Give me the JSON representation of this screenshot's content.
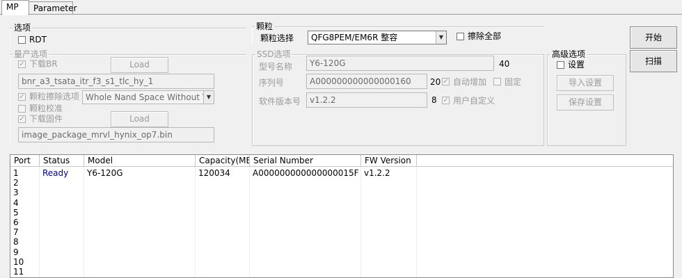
{
  "tabs": [
    {
      "label": "MP"
    },
    {
      "label": "Parameter"
    }
  ],
  "options": {
    "legend": "选项",
    "rdt_label": "RDT"
  },
  "mp_options": {
    "legend": "量产选项",
    "download_br_label": "下载BR",
    "download_br_checked": true,
    "load_button": "Load",
    "br_file": "bnr_a3_tsata_itr_f3_s1_tlc_hy_1",
    "erase_label": "颗粒擦除选项",
    "erase_checked": true,
    "erase_value": "Whole Nand Space Without WPE",
    "verify_label": "颗粒校准",
    "download_fw_label": "下载固件",
    "download_fw_checked": true,
    "load_button2": "Load",
    "fw_file": "image_package_mrvl_hynix_op7.bin"
  },
  "flash": {
    "legend": "颗粒",
    "select_label": "颗粒选择",
    "select_value": "QFG8PEM/EM6R 整容",
    "erase_all_label": "擦除全部"
  },
  "ssd": {
    "legend": "SSD选项",
    "model_label": "型号名称",
    "model_value": "Y6-120G",
    "model_len": "40",
    "serial_label": "序列号",
    "serial_value": "A000000000000000160",
    "serial_len": "20",
    "auto_inc_label": "自动增加",
    "auto_inc_checked": true,
    "fixed_label": "固定",
    "fw_label": "软件版本号",
    "fw_value": "v1.2.2",
    "fw_len": "8",
    "custom_label": "用户自定义",
    "custom_checked": true
  },
  "advanced": {
    "legend": "高级选项",
    "settings_label": "设置",
    "import_button": "导入设置",
    "save_button": "保存设置"
  },
  "actions": {
    "start_button": "开始",
    "scan_button": "扫描"
  },
  "table": {
    "columns": [
      "Port",
      "Status",
      "Model",
      "Capacity(MB)",
      "Serial Number",
      "FW Version"
    ],
    "rows": [
      {
        "port": "1",
        "status": "Ready",
        "model": "Y6-120G",
        "capacity": "120034",
        "serial": "A000000000000000015F",
        "fw": "v1.2.2"
      },
      {
        "port": "2",
        "status": "",
        "model": "",
        "capacity": "",
        "serial": "",
        "fw": ""
      },
      {
        "port": "3",
        "status": "",
        "model": "",
        "capacity": "",
        "serial": "",
        "fw": ""
      },
      {
        "port": "4",
        "status": "",
        "model": "",
        "capacity": "",
        "serial": "",
        "fw": ""
      },
      {
        "port": "5",
        "status": "",
        "model": "",
        "capacity": "",
        "serial": "",
        "fw": ""
      },
      {
        "port": "6",
        "status": "",
        "model": "",
        "capacity": "",
        "serial": "",
        "fw": ""
      },
      {
        "port": "7",
        "status": "",
        "model": "",
        "capacity": "",
        "serial": "",
        "fw": ""
      },
      {
        "port": "8",
        "status": "",
        "model": "",
        "capacity": "",
        "serial": "",
        "fw": ""
      },
      {
        "port": "9",
        "status": "",
        "model": "",
        "capacity": "",
        "serial": "",
        "fw": ""
      },
      {
        "port": "10",
        "status": "",
        "model": "",
        "capacity": "",
        "serial": "",
        "fw": ""
      },
      {
        "port": "11",
        "status": "",
        "model": "",
        "capacity": "",
        "serial": "",
        "fw": ""
      }
    ]
  },
  "colors": {
    "status_ready": "#000080",
    "disabled_text": "#9a9a9a"
  }
}
